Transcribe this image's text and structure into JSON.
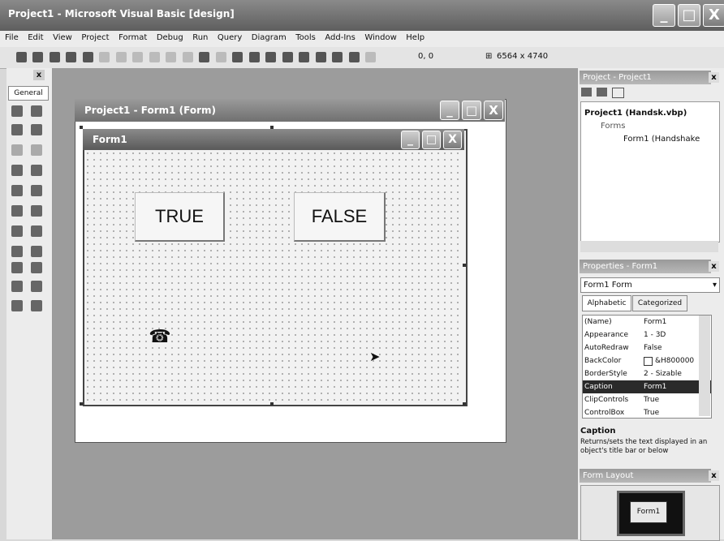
{
  "app": {
    "title": "Project1 - Microsoft Visual Basic [design]",
    "window_buttons": [
      "_",
      "□",
      "X"
    ]
  },
  "menu": [
    "File",
    "Edit",
    "View",
    "Project",
    "Format",
    "Debug",
    "Run",
    "Query",
    "Diagram",
    "Tools",
    "Add-Ins",
    "Window",
    "Help"
  ],
  "toolbar": {
    "position": "0, 0",
    "size": "6564 x 4740"
  },
  "toolbox": {
    "close": "x",
    "tab": "General"
  },
  "designer": {
    "title": "Project1 - Form1 (Form)",
    "window_buttons": [
      "_",
      "□",
      "X"
    ]
  },
  "form": {
    "title": "Form1",
    "window_buttons": [
      "_",
      "□",
      "X"
    ],
    "buttons": [
      "TRUE",
      "FALSE"
    ],
    "phone_icon": "☎"
  },
  "project_explorer": {
    "title": "Project - Project1",
    "close": "x",
    "tree": [
      "Project1 (Handsk.vbp)",
      "Forms",
      "Form1 (Handshake"
    ]
  },
  "properties": {
    "title": "Properties - Form1",
    "close": "x",
    "object": "Form1 Form",
    "tabs": [
      "Alphabetic",
      "Categorized"
    ],
    "rows": [
      {
        "name": "(Name)",
        "value": "Form1"
      },
      {
        "name": "Appearance",
        "value": "1 - 3D"
      },
      {
        "name": "AutoRedraw",
        "value": "False"
      },
      {
        "name": "BackColor",
        "value": "&H800000"
      },
      {
        "name": "BorderStyle",
        "value": "2 - Sizable"
      },
      {
        "name": "Caption",
        "value": "Form1"
      },
      {
        "name": "ClipControls",
        "value": "True"
      },
      {
        "name": "ControlBox",
        "value": "True"
      }
    ],
    "selected_row": "Caption",
    "description_title": "Caption",
    "description_text": "Returns/sets the text displayed in an object's title bar or below"
  },
  "form_layout": {
    "title": "Form Layout",
    "close": "x",
    "form_label": "Form1"
  }
}
